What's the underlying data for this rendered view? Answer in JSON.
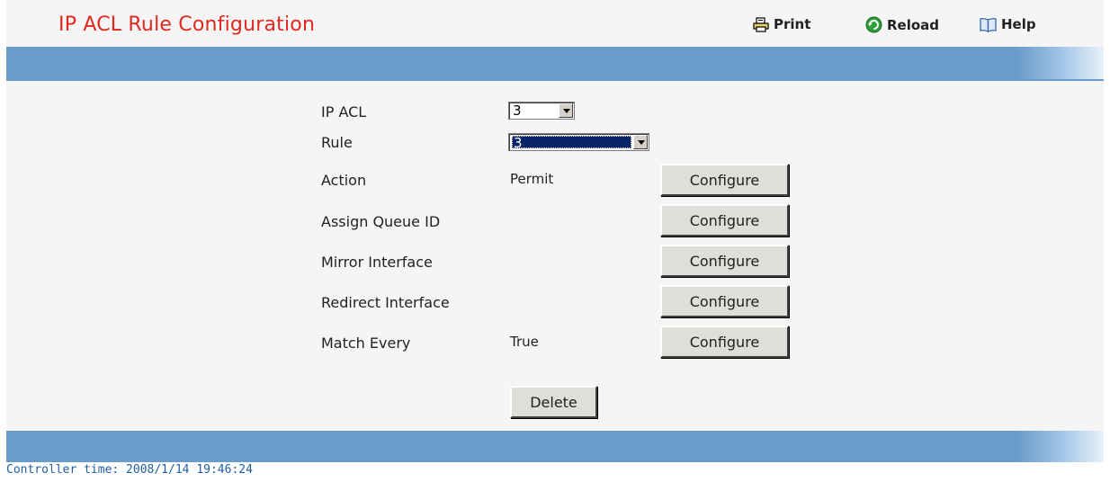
{
  "header": {
    "title": "IP ACL Rule Configuration",
    "print_label": "Print",
    "reload_label": "Reload",
    "help_label": "Help"
  },
  "form": {
    "ip_acl": {
      "label": "IP ACL",
      "value": "3"
    },
    "rule": {
      "label": "Rule",
      "value": "3"
    },
    "action": {
      "label": "Action",
      "value": "Permit",
      "button": "Configure"
    },
    "assign_queue": {
      "label": "Assign Queue ID",
      "button": "Configure"
    },
    "mirror_interface": {
      "label": "Mirror Interface",
      "button": "Configure"
    },
    "redirect_interface": {
      "label": "Redirect Interface",
      "button": "Configure"
    },
    "match_every": {
      "label": "Match Every",
      "value": "True",
      "button": "Configure"
    },
    "delete_button": "Delete"
  },
  "footer": {
    "controller_time": "Controller time: 2008/1/14 19:46:24"
  },
  "colors": {
    "title": "#e0281e",
    "bar": "#6a9bc9",
    "footer_text": "#1f5fa0"
  }
}
